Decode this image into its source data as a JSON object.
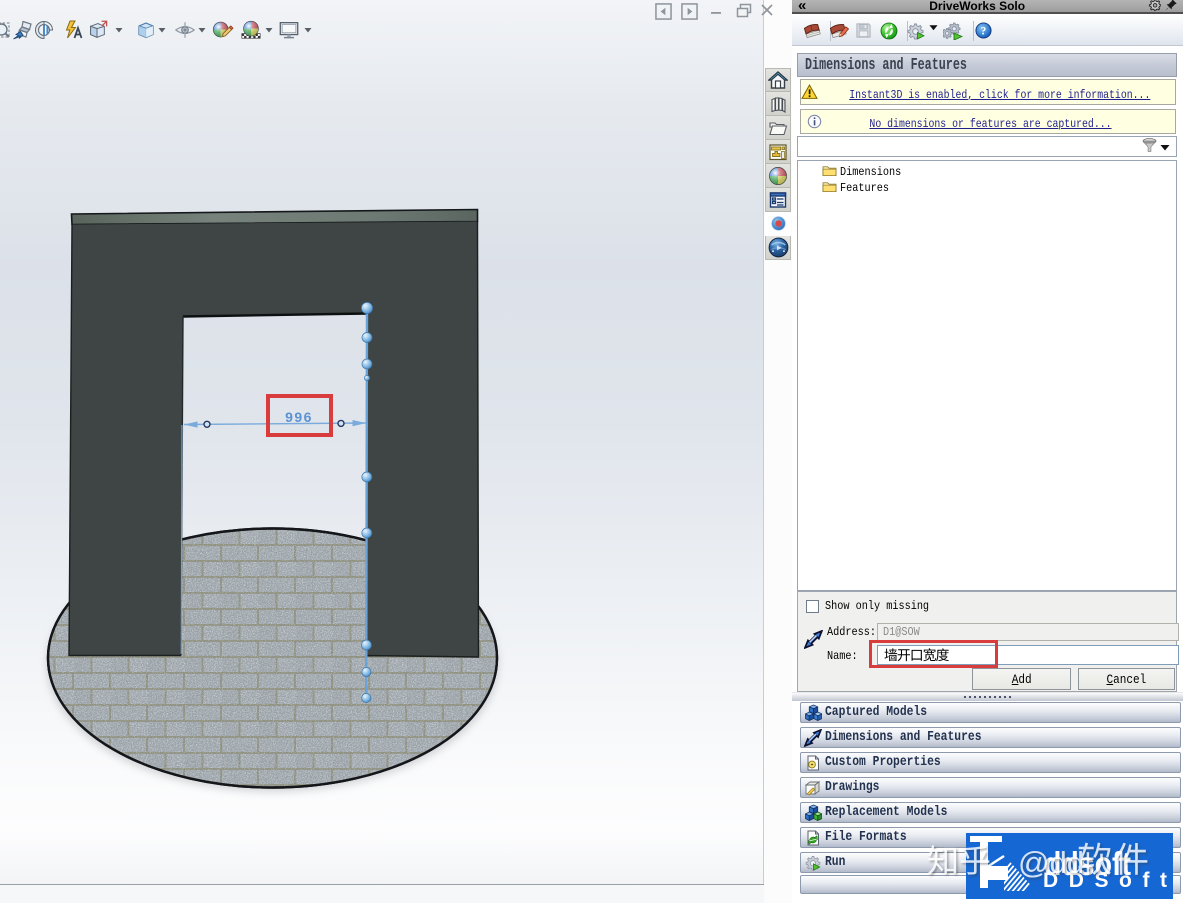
{
  "window": {
    "controls": [
      "previous-pane",
      "next-pane",
      "minimize",
      "restore",
      "close"
    ]
  },
  "hud_toolbar": {
    "icons": [
      "zoom-to-fit",
      "zoom-to-area",
      "section-view",
      "annotation-view",
      "view-orientation",
      "display-style",
      "hide-show-items",
      "edit-appearance",
      "apply-scene",
      "view-settings"
    ]
  },
  "task_pane": {
    "tabs": [
      "home",
      "design-library",
      "file-explorer",
      "view-palette",
      "appearances",
      "custom-properties",
      "driveworks-solo",
      "solidworks-forum"
    ],
    "active_tab": "driveworks-solo"
  },
  "viewport": {
    "dimension_value": "996",
    "dimension_color": "#4a86c8",
    "annotation_color": "#d83c3c"
  },
  "panel": {
    "title": "DriveWorks Solo",
    "collapse_glyph": "«",
    "header": "Dimensions and Features",
    "notices": [
      {
        "icon": "warning",
        "text": "Instant3D is enabled, click for more information..."
      },
      {
        "icon": "info",
        "text": "No dimensions or features are captured..."
      }
    ],
    "tree": [
      {
        "icon": "folder",
        "label": "Dimensions"
      },
      {
        "icon": "folder",
        "label": "Features"
      }
    ],
    "show_only_missing_label": "Show only missing",
    "address_label": "Address:",
    "address_value": "D1@SOW",
    "name_label": "Name:",
    "name_value": "墙开口宽度",
    "add_label": "Add",
    "add_label_head": "A",
    "add_label_tail": "dd",
    "cancel_label_head": "C",
    "cancel_label_tail": "ancel",
    "sections": [
      {
        "icon": "captured-models",
        "label": "Captured Models"
      },
      {
        "icon": "dimensions-and-features",
        "label": "Dimensions and Features"
      },
      {
        "icon": "custom-properties",
        "label": "Custom Properties"
      },
      {
        "icon": "drawings",
        "label": "Drawings"
      },
      {
        "icon": "replacement-models",
        "label": "Replacement Models"
      },
      {
        "icon": "file-formats",
        "label": "File Formats"
      },
      {
        "icon": "run",
        "label": "Run"
      }
    ],
    "toolbar_icons": [
      "capture-book",
      "edit-book",
      "save",
      "driveworks-home",
      "generate-options",
      "run-generate",
      "help"
    ]
  },
  "watermark": {
    "overlay_text": "知乎 @dd软件",
    "logo_text": "DDSoft",
    "logo_color": "#1567d3"
  }
}
